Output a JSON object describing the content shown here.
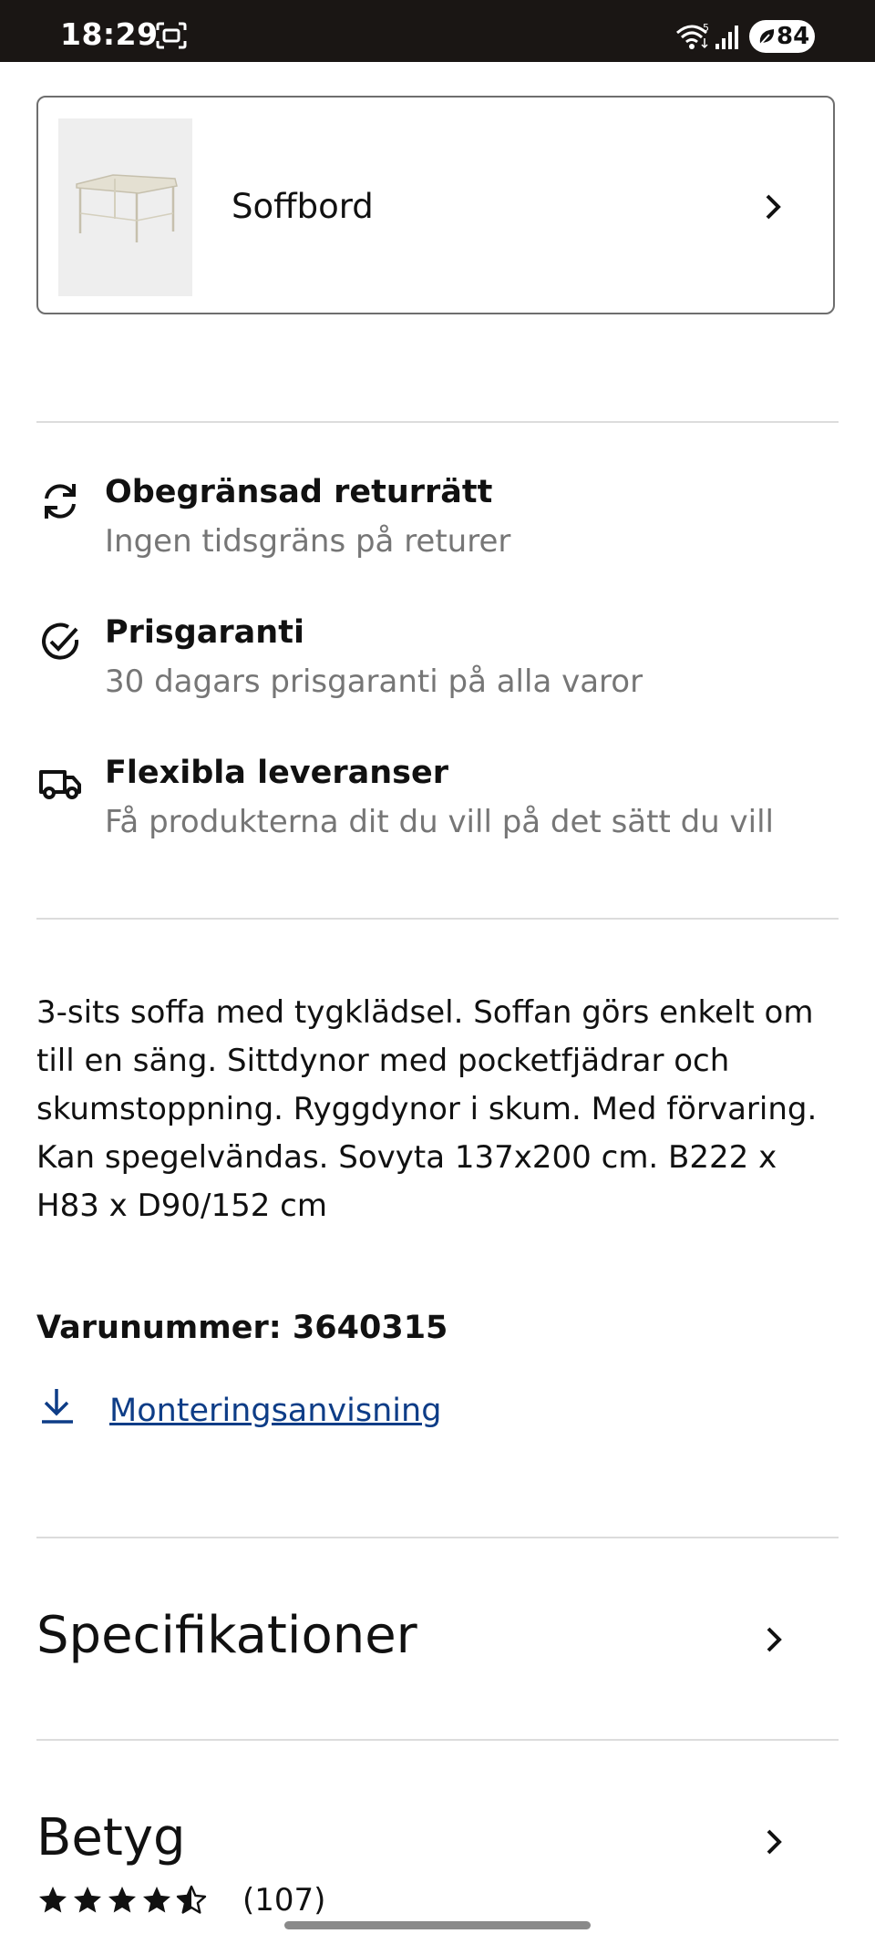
{
  "status_bar": {
    "time": "18:29",
    "battery": "84",
    "icons": [
      "screenshot-icon",
      "wifi-icon",
      "cell-signal-icon",
      "battery-icon"
    ]
  },
  "related_product": {
    "label": "Soffbord",
    "thumbnail": "coffee-table-image"
  },
  "features": [
    {
      "icon": "returns-icon",
      "title": "Obegränsad returrätt",
      "subtitle": "Ingen tidsgräns på returer"
    },
    {
      "icon": "check-circle-icon",
      "title": "Prisgaranti",
      "subtitle": "30 dagars prisgaranti på alla varor"
    },
    {
      "icon": "delivery-truck-icon",
      "title": "Flexibla leveranser",
      "subtitle": "Få produkterna dit du vill på det sätt du vill"
    }
  ],
  "description": {
    "lines": [
      "3-sits soffa med tygklädsel. Soffan görs enkelt om",
      "till en säng. Sittdynor med pocketfjädrar och",
      "skumstoppning. Ryggdynor i skum. Med förvaring.",
      "Kan spegelvändas. Sovyta 137x200 cm. B222 x",
      "H83 x D90/152 cm"
    ]
  },
  "article_number": "Varunummer: 3640315",
  "assembly_link": "Monteringsanvisning",
  "sections": {
    "specifications": "Specifikationer",
    "rating_title": "Betyg",
    "rating_value": 4.5,
    "rating_max": 5,
    "rating_count": "(107)"
  },
  "colors": {
    "link": "#0e3d87",
    "muted_text": "#767676",
    "divider": "#dcdcdc",
    "status_bar": "#1a1614"
  }
}
